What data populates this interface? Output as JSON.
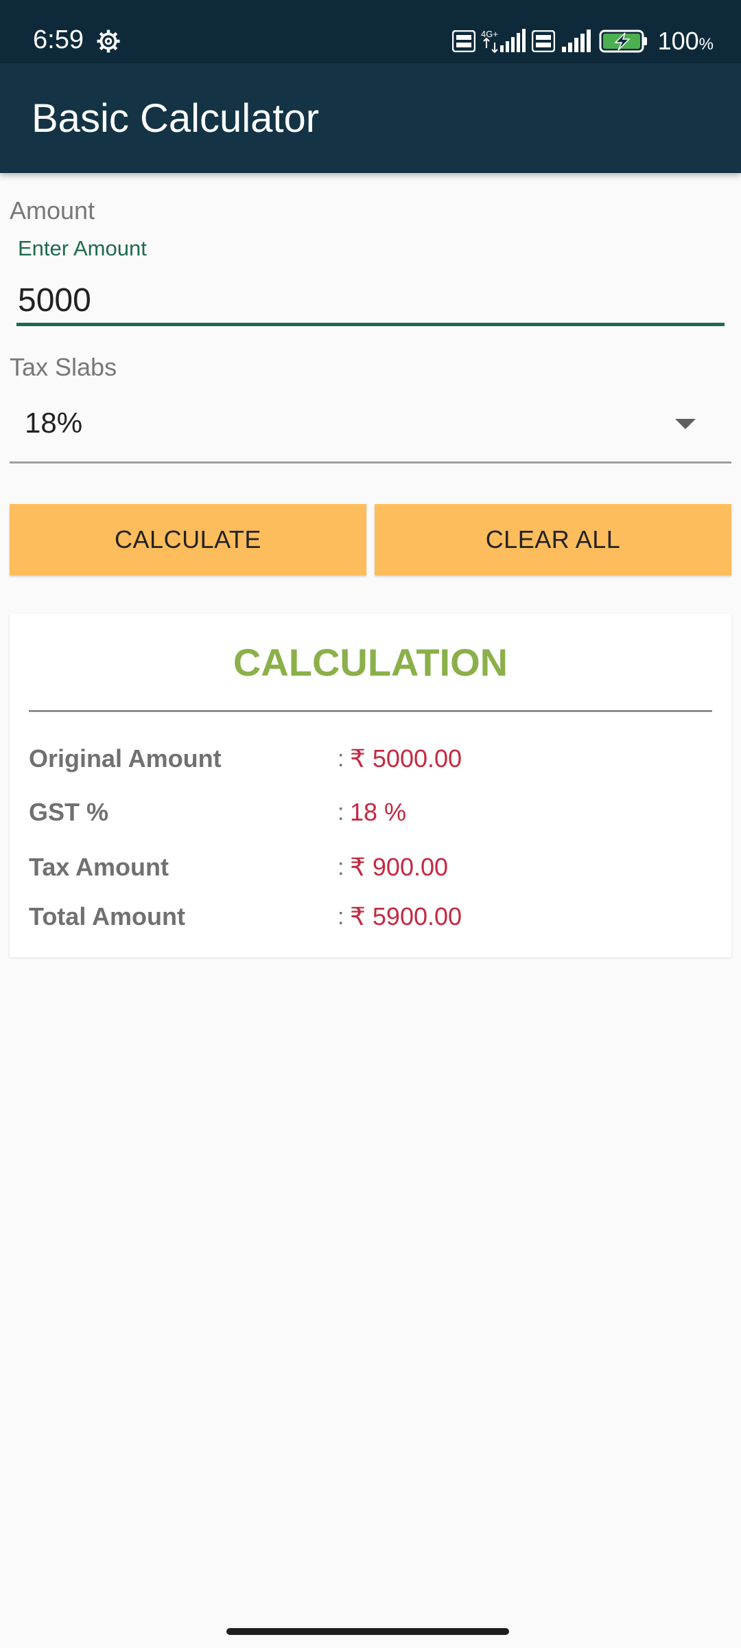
{
  "status_bar": {
    "time": "6:59",
    "network1": "4G+",
    "battery_pct": "100",
    "battery_unit": "%"
  },
  "app_bar": {
    "title": "Basic Calculator"
  },
  "amount": {
    "section_label": "Amount",
    "hint": "Enter Amount",
    "value": "5000"
  },
  "tax": {
    "section_label": "Tax Slabs",
    "selected": "18%"
  },
  "buttons": {
    "calculate": "CALCULATE",
    "clear_all": "CLEAR ALL"
  },
  "result": {
    "title": "CALCULATION",
    "rows": [
      {
        "label": "Original Amount",
        "sep": ":",
        "value": "₹ 5000.00"
      },
      {
        "label": "GST %",
        "sep": ":",
        "value": "18 %"
      },
      {
        "label": "Tax Amount",
        "sep": ":",
        "value": "₹ 900.00"
      },
      {
        "label": "Total Amount",
        "sep": ":",
        "value": "₹ 5900.00"
      }
    ]
  },
  "colors": {
    "app_bar": "#143446",
    "accent_green": "#1d6b4d",
    "button": "#fdbd5c",
    "title_green": "#8bb04a",
    "value_red": "#c62840"
  }
}
